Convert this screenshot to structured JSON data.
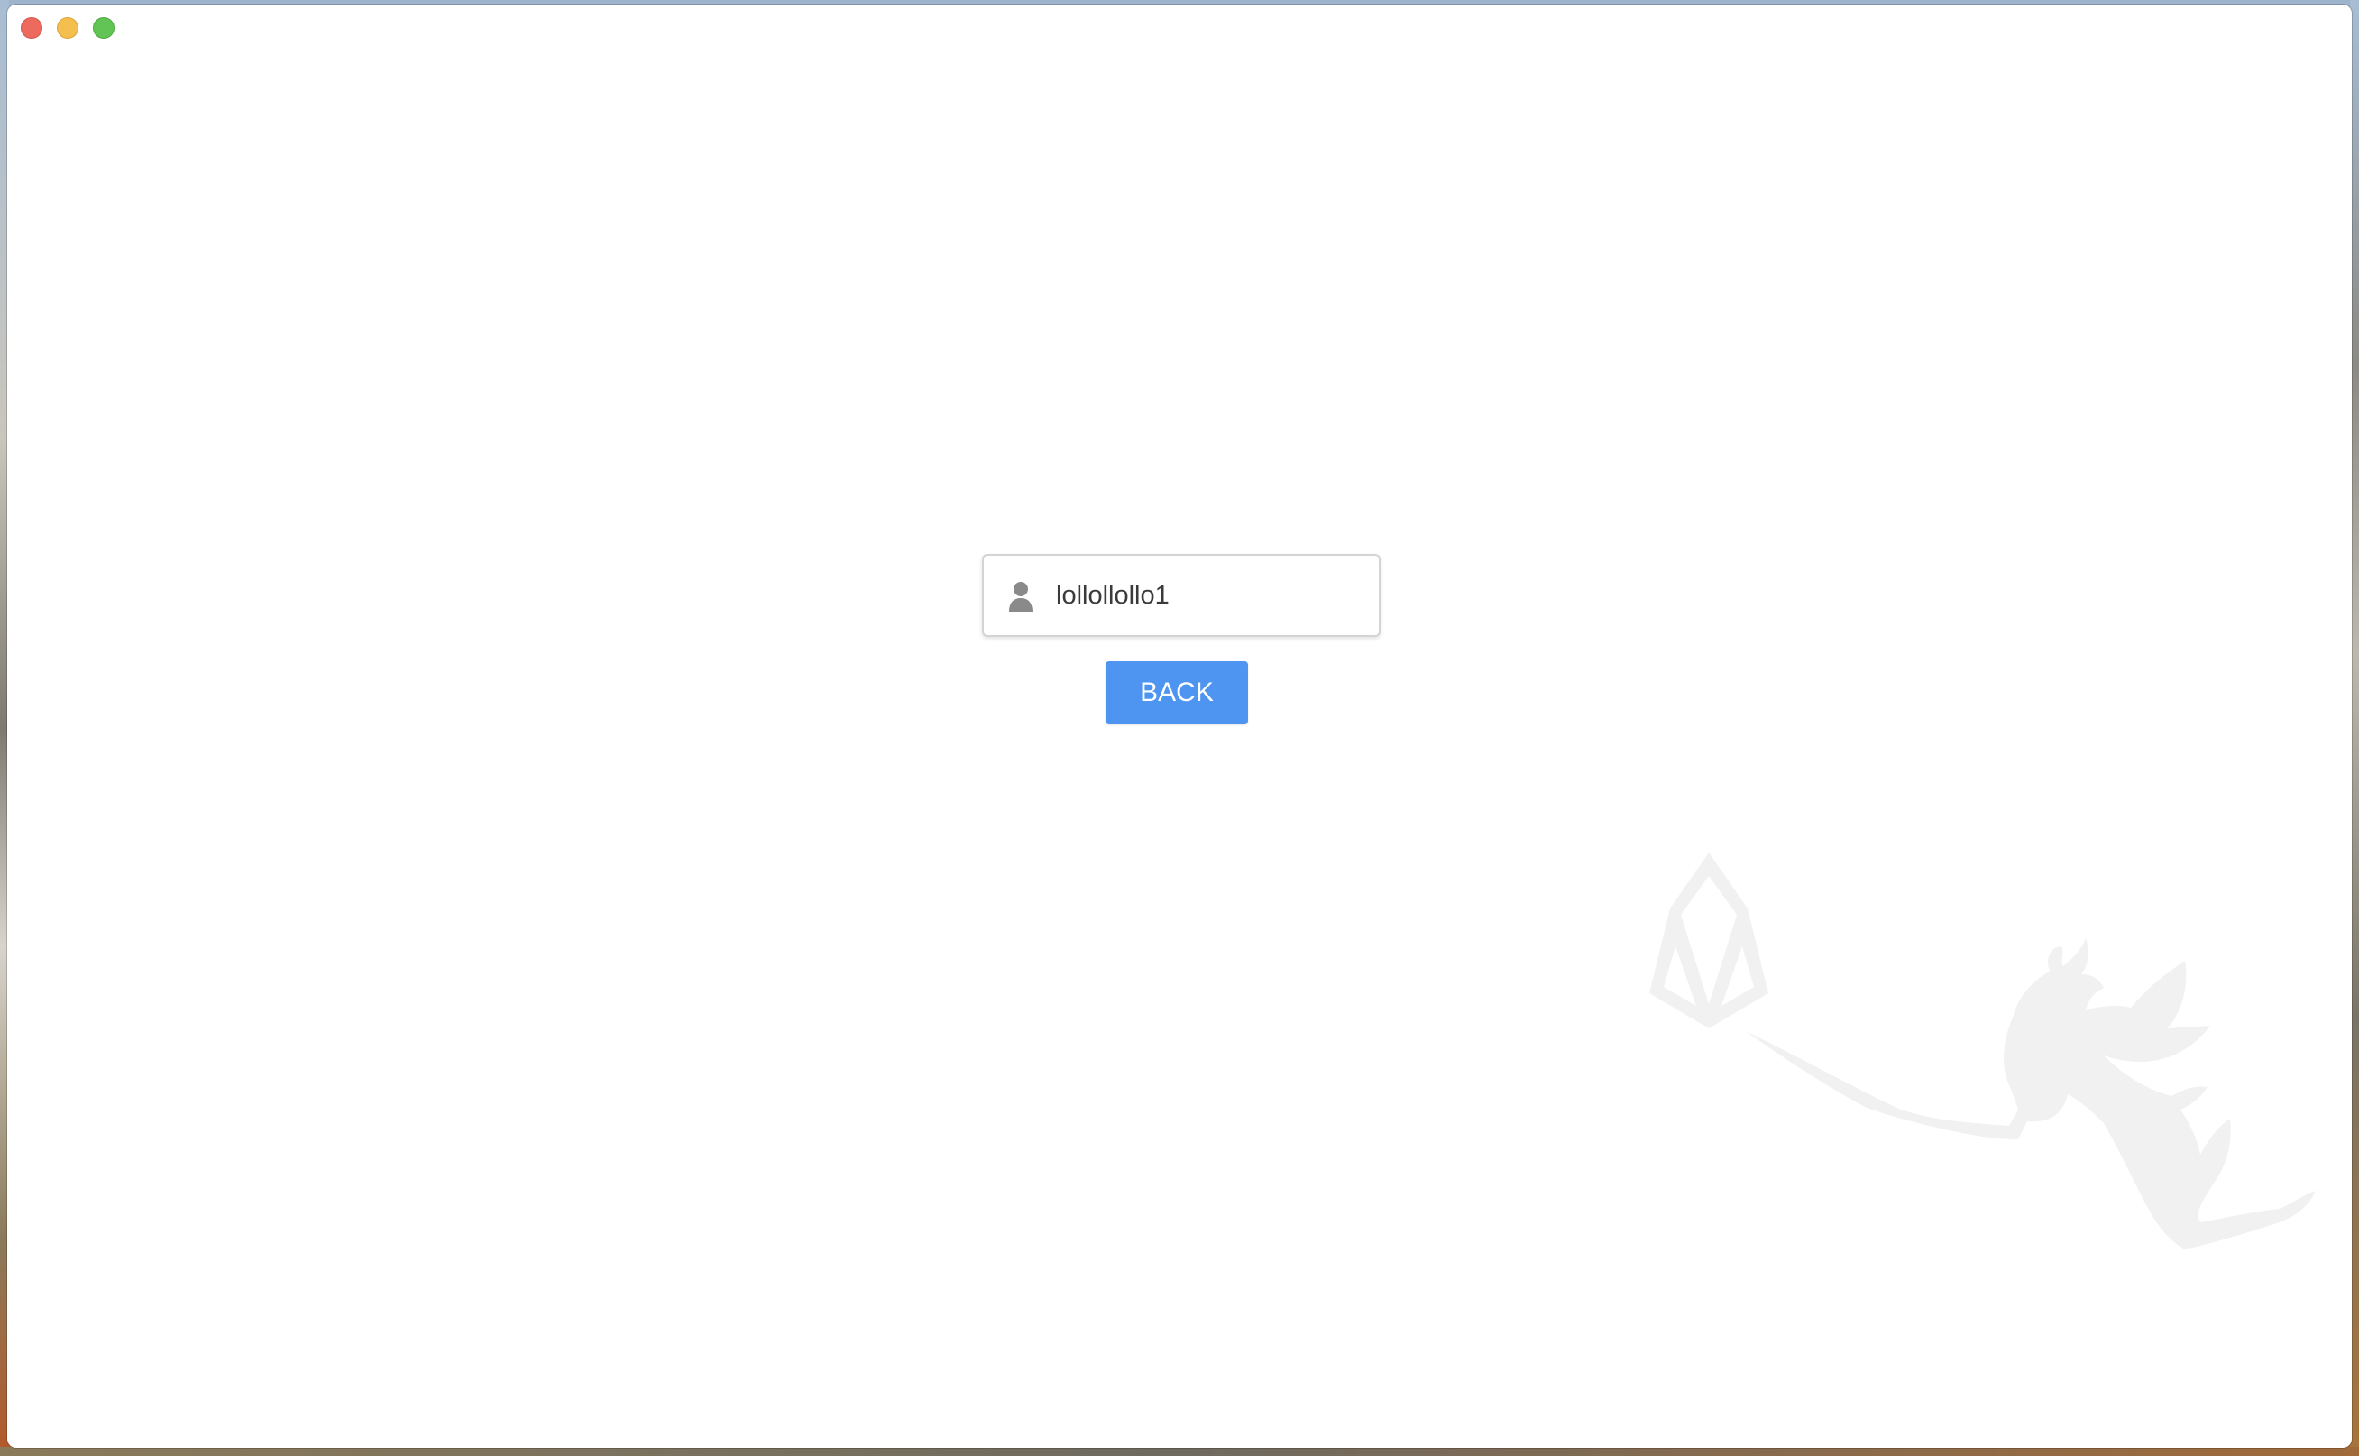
{
  "window": {
    "traffic_lights": {
      "close_color": "#ec6a5e",
      "minimize_color": "#f4bf4f",
      "maximize_color": "#61c454"
    }
  },
  "account": {
    "icon": "user-icon",
    "value": "lollollollo1"
  },
  "actions": {
    "back_label": "BACK",
    "accent_color": "#4e95f2"
  },
  "watermark": {
    "icons": [
      "eos-logo-icon",
      "fairy-icon"
    ]
  }
}
